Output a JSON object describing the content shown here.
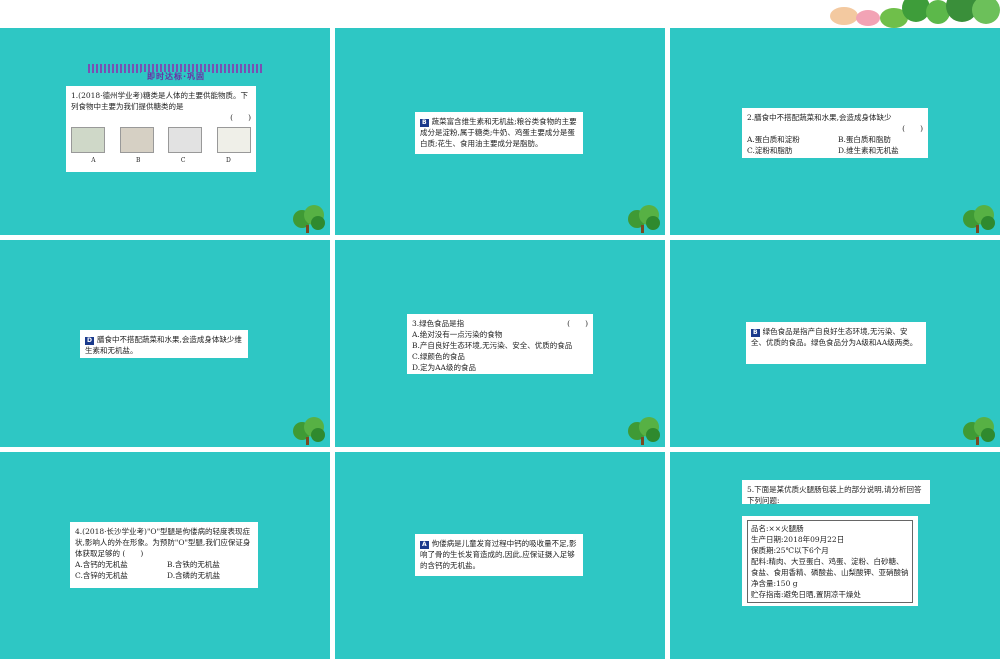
{
  "colors": {
    "slide_bg": "#2ec7c4",
    "answer_badge": "#1b3a8c",
    "banner": "#6a2fa3"
  },
  "slide1": {
    "banner": "即时达标·巩固",
    "question": "1.(2018·德州学业考)糖类是人体的主要供能物质。下列食物中主要为我们提供糖类的是",
    "bracket": "(　　)",
    "option_labels": [
      "A",
      "B",
      "C",
      "D"
    ]
  },
  "slide2": {
    "answer": "B",
    "explanation": "蔬菜富含维生素和无机盐;粮谷类食物的主要成分是淀粉,属于糖类;牛奶、鸡蛋主要成分是蛋白质;花生、食用油主要成分是脂肪。"
  },
  "slide3": {
    "question": "2.膳食中不搭配蔬菜和水果,会造成身体缺少",
    "bracket": "(　　)",
    "options": [
      "A.蛋白质和淀粉",
      "B.蛋白质和脂肪",
      "C.淀粉和脂肪",
      "D.维生素和无机盐"
    ]
  },
  "slide4": {
    "answer": "D",
    "explanation": "膳食中不搭配蔬菜和水果,会造成身体缺少维生素和无机盐。"
  },
  "slide5": {
    "question": "3.绿色食品是指",
    "bracket": "(　　)",
    "options": [
      "A.绝对没有一点污染的食物",
      "B.产自良好生态环境,无污染、安全、优质的食品",
      "C.绿颜色的食品",
      "D.定为AA级的食品"
    ]
  },
  "slide6": {
    "answer": "B",
    "explanation": "绿色食品是指产自良好生态环境,无污染、安全、优质的食品。绿色食品分为A级和AA级两类。"
  },
  "slide7": {
    "question": "4.(2018·长沙学业考)\"O\"型腿是佝偻病的轻度表现症状,影响人的外在形象。为预防\"O\"型腿,我们应保证身体获取足够的",
    "bracket": "(　　)",
    "options": [
      "A.含钙的无机盐",
      "B.含铁的无机盐",
      "C.含锌的无机盐",
      "D.含磷的无机盐"
    ]
  },
  "slide8": {
    "answer": "A",
    "explanation": "佝偻病是儿童发育过程中钙的吸收量不足,影响了骨的生长发育造成的,因此,应保证摄入足够的含钙的无机盐。"
  },
  "slide9": {
    "question": "5.下面是某优质火腿肠包装上的部分说明,请分析回答下列问题:",
    "info": [
      "品名:××火腿肠",
      "生产日期:2018年09月22日",
      "保质期:25℃以下6个月",
      "配料:精肉、大豆蛋白、鸡蛋、淀粉、白砂糖、食盐、食用香精、磷酸盐、山梨酸钾、亚硝酸钠",
      "净含量:150 g",
      "贮存指南:避免日晒,置阴凉干燥处"
    ]
  }
}
